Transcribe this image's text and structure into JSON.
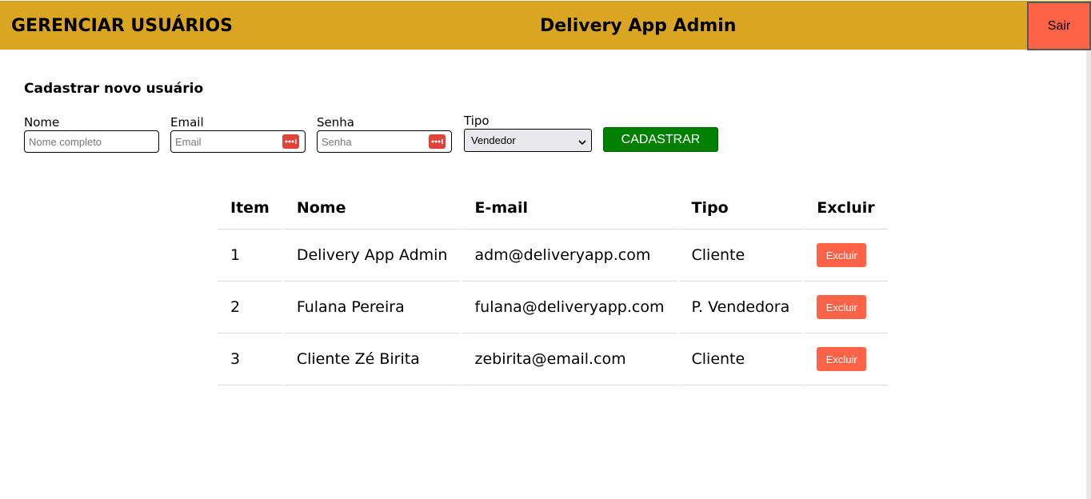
{
  "header": {
    "page_title": "GERENCIAR USUÁRIOS",
    "app_title": "Delivery App Admin",
    "logout_label": "Sair"
  },
  "form": {
    "title": "Cadastrar novo usuário",
    "name": {
      "label": "Nome",
      "placeholder": "Nome completo",
      "value": ""
    },
    "email": {
      "label": "Email",
      "placeholder": "Email",
      "value": ""
    },
    "password": {
      "label": "Senha",
      "placeholder": "Senha",
      "value": ""
    },
    "type": {
      "label": "Tipo",
      "selected": "Vendedor"
    },
    "submit_label": "CADASTRAR",
    "password_manager_icon": "key-dots-icon"
  },
  "table": {
    "headers": [
      "Item",
      "Nome",
      "E-mail",
      "Tipo",
      "Excluir"
    ],
    "rows": [
      {
        "item": "1",
        "nome": "Delivery App Admin",
        "email": "adm@deliveryapp.com",
        "tipo": "Cliente",
        "action": "Excluir"
      },
      {
        "item": "2",
        "nome": "Fulana Pereira",
        "email": "fulana@deliveryapp.com",
        "tipo": "P. Vendedora",
        "action": "Excluir"
      },
      {
        "item": "3",
        "nome": "Cliente Zé Birita",
        "email": "zebirita@email.com",
        "tipo": "Cliente",
        "action": "Excluir"
      }
    ]
  },
  "colors": {
    "header_bg": "#daa520",
    "logout_bg": "#ff6347",
    "submit_bg": "#008000",
    "delete_bg": "#ff6347"
  }
}
